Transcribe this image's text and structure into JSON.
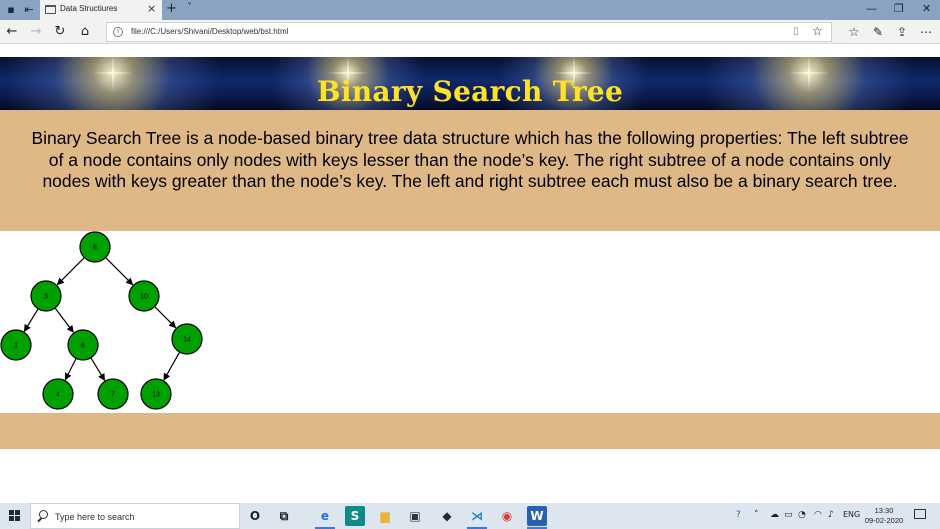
{
  "browser": {
    "tab_title": "Data Structiures",
    "url": "file:///C:/Users/Shivani/Desktop/web/bst.html",
    "icons": {
      "tab_actions": "tab-actions-icon",
      "set_aside": "set-aside-tabs-icon",
      "tab_close": "×",
      "new_tab": "+",
      "tab_list": "˅",
      "minimize": "—",
      "restore": "❐",
      "close": "✕",
      "back": "←",
      "forward": "→",
      "refresh": "↻",
      "home": "⌂",
      "info": "i",
      "reading_view": "▯",
      "favorite": "☆",
      "favorites": "☆",
      "notes": "✎",
      "share": "⇪",
      "more": "⋯"
    }
  },
  "page": {
    "banner_title": "Binary Search Tree",
    "description": "Binary Search Tree is a node-based binary tree data structure which has the following properties: The left subtree of a node contains only nodes with keys lesser than the node’s key. The right subtree of a node contains only nodes with keys greater than the node’s key. The left and right subtree each must also be a binary search tree.",
    "colors": {
      "band": "#deb887",
      "title": "#ffe227",
      "node_fill": "#00a000",
      "node_stroke": "#000000"
    },
    "tree": {
      "nodes": [
        {
          "key": "8"
        },
        {
          "key": "3"
        },
        {
          "key": "10"
        },
        {
          "key": "1"
        },
        {
          "key": "6"
        },
        {
          "key": "14"
        },
        {
          "key": "4"
        },
        {
          "key": "7"
        },
        {
          "key": "13"
        }
      ],
      "edges": [
        [
          "8",
          "3"
        ],
        [
          "8",
          "10"
        ],
        [
          "3",
          "1"
        ],
        [
          "3",
          "6"
        ],
        [
          "10",
          "14"
        ],
        [
          "6",
          "4"
        ],
        [
          "6",
          "7"
        ],
        [
          "14",
          "13"
        ]
      ]
    }
  },
  "taskbar": {
    "search_placeholder": "Type here to search",
    "apps": [
      {
        "name": "cortana",
        "glyph": "O"
      },
      {
        "name": "task-view",
        "glyph": "⧉"
      },
      {
        "name": "edge",
        "glyph": "e"
      },
      {
        "name": "sway",
        "glyph": "S"
      },
      {
        "name": "file-explorer",
        "glyph": "▆"
      },
      {
        "name": "store",
        "glyph": "▣"
      },
      {
        "name": "dropbox",
        "glyph": "◆"
      },
      {
        "name": "vscode",
        "glyph": "⋊"
      },
      {
        "name": "chrome",
        "glyph": "◉"
      },
      {
        "name": "word",
        "glyph": "W"
      }
    ],
    "language": "ENG",
    "time": "13:30",
    "date": "09-02-2020"
  }
}
